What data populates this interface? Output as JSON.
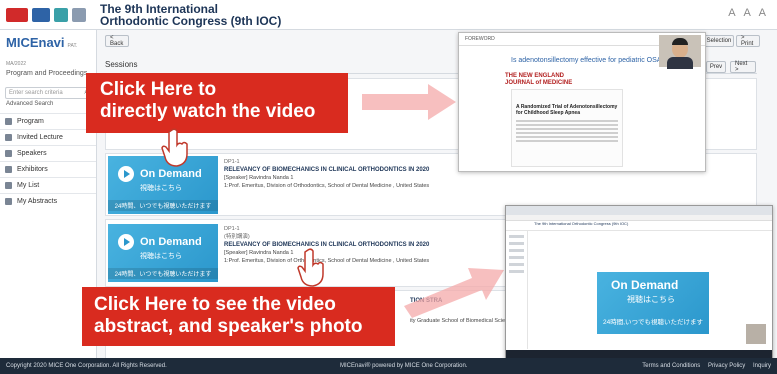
{
  "header": {
    "congress_title_line1": "The 9th International",
    "congress_title_line2": "Orthodontic Congress (9th IOC)",
    "font_size_control": "A A A"
  },
  "sidebar": {
    "brand": "MICEnavi",
    "brand_version": "PAT. MA/2022",
    "brand_sub": "Program and Proceedings",
    "search_placeholder": "Enter search criteria",
    "advanced_search": "Advanced Search",
    "menu": [
      {
        "label": "Program",
        "icon": "calendar-icon"
      },
      {
        "label": "Invited Lecture",
        "icon": "lecture-icon"
      },
      {
        "label": "Speakers",
        "icon": "person-icon"
      },
      {
        "label": "Exhibitors",
        "icon": "booth-icon"
      },
      {
        "label": "My List",
        "icon": "list-icon"
      },
      {
        "label": "My Abstracts",
        "icon": "document-icon"
      }
    ]
  },
  "toolbar": {
    "back": "< Back",
    "selection": "Selection",
    "print": "> Print",
    "prev": "Prev",
    "next": "Next >"
  },
  "sessions": {
    "title": "Sessions",
    "items": [
      {
        "code": "DP1-1",
        "title": "RELEVANCY OF BIOMECHANICS IN CLINICAL ORTHODONTICS IN 2020",
        "speaker": "[Speaker] Ravindra Nanda 1",
        "affiliation": "1:Prof. Emeritus, Division of Orthodontics, School of Dental Medicine , United States",
        "thumb_main": "On Demand",
        "thumb_jp1": "視聴はこちら",
        "thumb_jp2": "24時間、いつでも視聴いただけます"
      },
      {
        "code": "DP1-1",
        "tag": "(特別講演)",
        "title": "RELEVANCY OF BIOMECHANICS IN CLINICAL ORTHODONTICS IN 2020",
        "speaker": "[Speaker] Ravindra Nanda 1",
        "affiliation": "1:Prof. Emeritus, Division of Orthodontics, School of Dental Medicine , United States",
        "thumb_main": "On Demand",
        "thumb_jp1": "視聴はこちら",
        "thumb_jp2": "24時間、いつでも視聴いただけます"
      }
    ],
    "partial_title_fragment": "TION STRA",
    "partial_affiliation_fragment": "ity Graduate School of Biomedical Sciences, ,"
  },
  "callouts": {
    "top_line1": "Click Here to",
    "top_line2": "directly watch the video",
    "bottom_line1": "Click Here to see the video",
    "bottom_line2": "abstract, and speaker's photo"
  },
  "doc_preview": {
    "header": "FOREWORD",
    "question": "Is adenotonsillectomy effective for pediatric OSA?",
    "journal_line1": "THE NEW ENGLAND",
    "journal_line2": "JOURNAL of MEDICINE",
    "paper_title": "A Randomized Trial of Adenotonsillectomy for Childhood Sleep Apnea"
  },
  "browser_preview": {
    "header_title": "The 9th International Orthodontic Congress (9th IOC)",
    "main": "On Demand",
    "jp1": "視聴はこちら",
    "jp2": "24時間,いつでも視聴いただけます"
  },
  "footer": {
    "copyright": "Copyright 2020 MICE One Corporation. All Rights Reserved.",
    "powered": "MICEnavi® powered by MICE One Corporation.",
    "links": [
      "Terms and Conditions",
      "Privacy Policy",
      "Inquiry"
    ]
  },
  "colors": {
    "callout_red": "#d92b1f",
    "on_demand_blue": "#2b97cc",
    "footer_dark": "#1e2b3a",
    "arrow_pink": "#f4a9a9"
  }
}
